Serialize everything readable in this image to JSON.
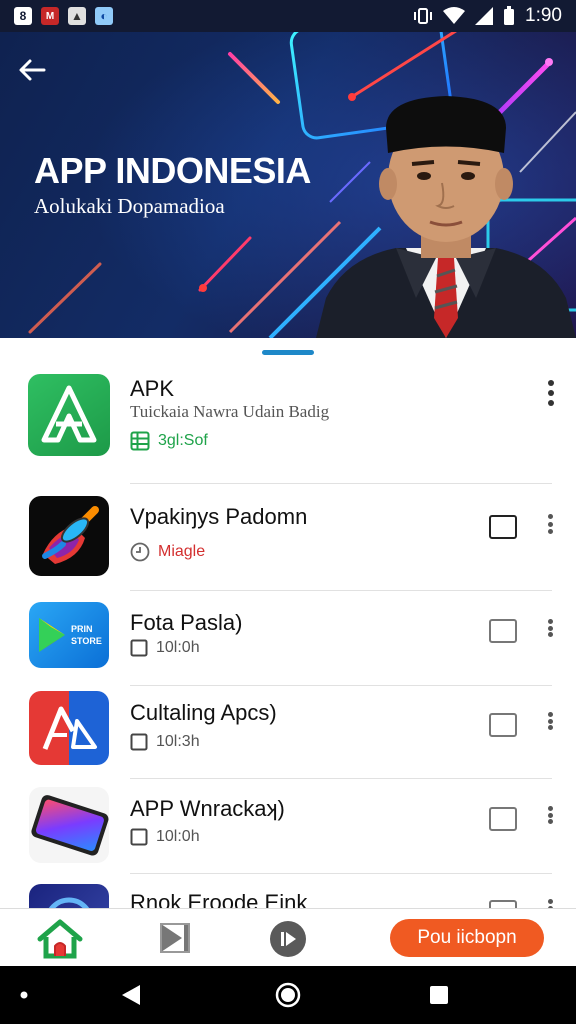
{
  "status_bar": {
    "time": "1:90"
  },
  "hero": {
    "title": "APP INDONESIA",
    "subtitle": "Aolukaki Dopamadioa"
  },
  "list": [
    {
      "title": "APK",
      "subtitle": "Tuickaia Nawra Udain Badig",
      "meta": "3gl:Sof",
      "meta_icon": "spreadsheet-icon"
    },
    {
      "title": "Vpakiŋys Padomn",
      "meta": "Miagle",
      "meta_icon": "clock-icon"
    },
    {
      "title": "Fota  Pasla)",
      "meta": "10l:0h",
      "meta_icon": "checkbox-icon",
      "icon_text": "PRIN STORE"
    },
    {
      "title": "Cultaling Apcs)",
      "meta": "10l:3h",
      "meta_icon": "checkbox-icon"
    },
    {
      "title": "APP Wnrackaʞ)",
      "meta": "10l:0h",
      "meta_icon": "checkbox-icon"
    },
    {
      "title": "Rnok Eroode Eink"
    }
  ],
  "bottom_bar": {
    "primary_button": "Pou iicbopn"
  },
  "colors": {
    "accent": "#f05a22",
    "hero_bg": "#132c66",
    "green": "#1fa34a",
    "red_meta": "#d32f2f",
    "handle": "#1e88c8"
  }
}
